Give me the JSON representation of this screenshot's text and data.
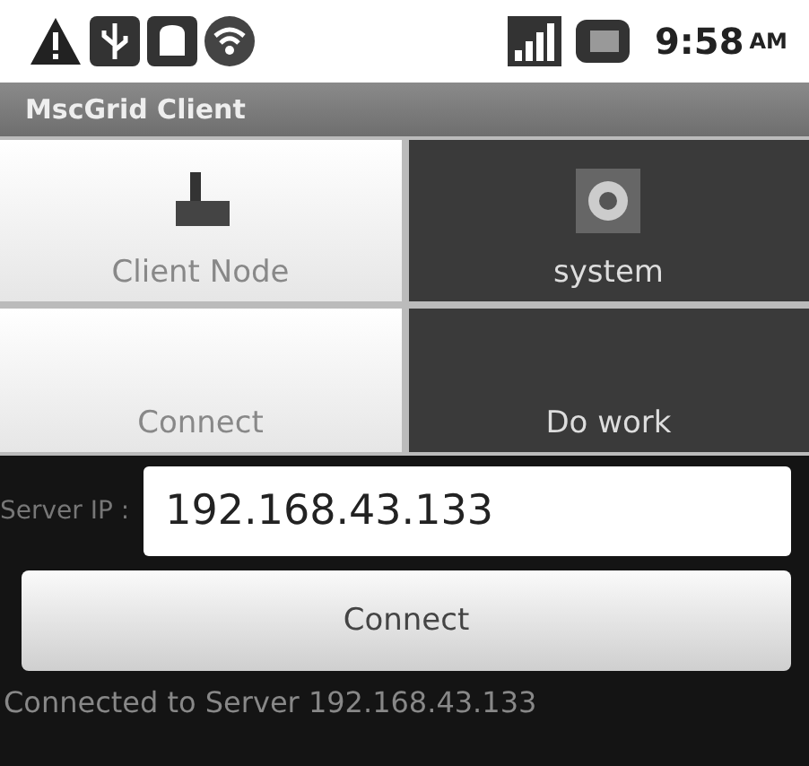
{
  "status_bar": {
    "time": "9:58",
    "ampm": "AM"
  },
  "window": {
    "title": "MscGrid Client"
  },
  "tabs": [
    {
      "label": "Client Node",
      "selected": true,
      "kind": "node"
    },
    {
      "label": "system",
      "selected": false,
      "kind": "gear"
    }
  ],
  "subtabs": [
    {
      "label": "Connect",
      "selected": true
    },
    {
      "label": "Do work",
      "selected": false
    }
  ],
  "form": {
    "label": "Server IP :",
    "value": "192.168.43.133",
    "button": "Connect"
  },
  "message": "Connected to Server 192.168.43.133"
}
